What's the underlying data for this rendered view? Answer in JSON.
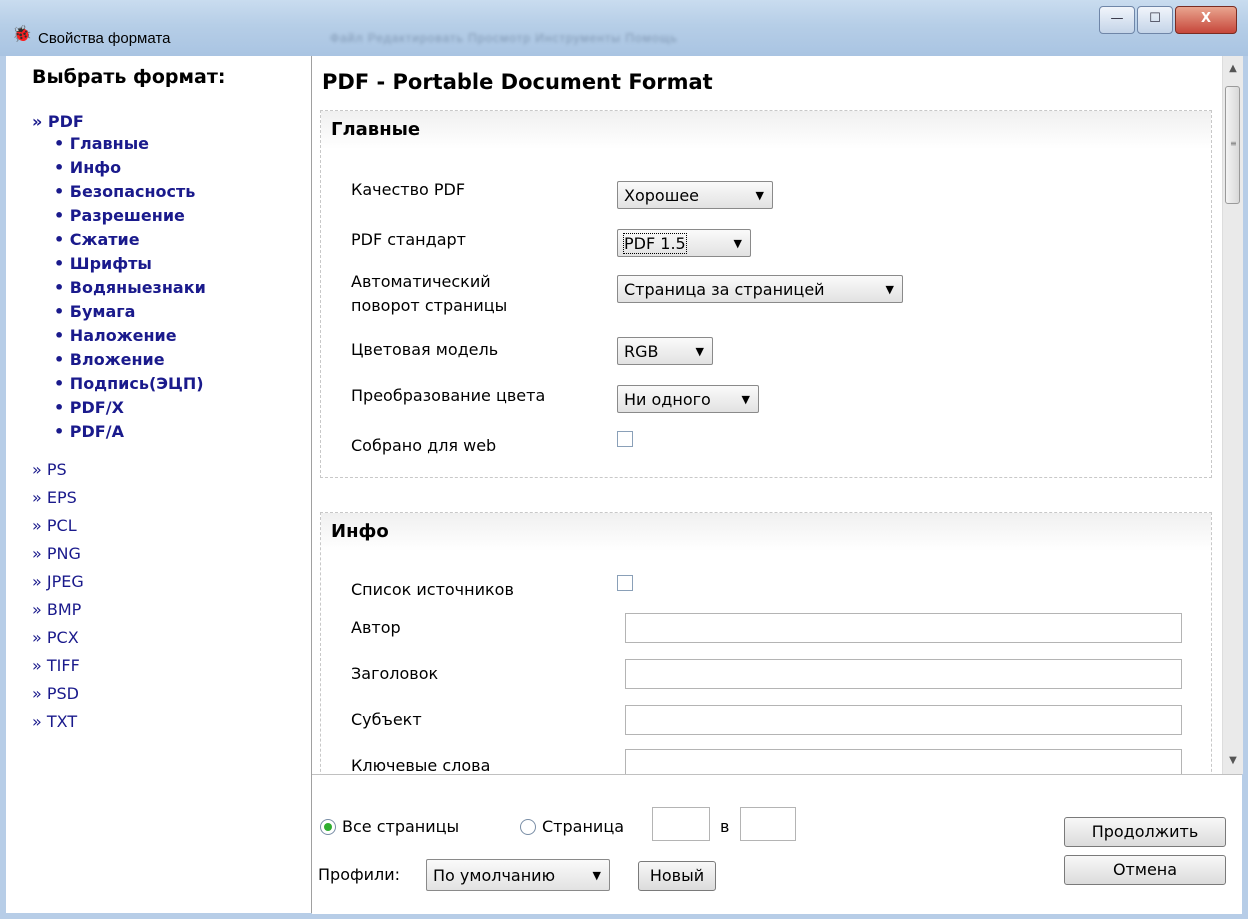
{
  "window": {
    "title": "Свойства формата",
    "blurred_menu": "Файл   Редактировать   Просмотр   Инструменты   Помощь",
    "minimize": "—",
    "maximize": "☐",
    "close": "X"
  },
  "sidebar": {
    "heading": "Выбрать формат:",
    "active_format": "» PDF",
    "pdf_sections": [
      "• Главные",
      "• Инфо",
      "• Безопасность",
      "• Разрешение",
      "• Сжатие",
      "• Шрифты",
      "• Водяныезнаки",
      "• Бумага",
      "• Наложение",
      "• Вложение",
      "• Подпись(ЭЦП)",
      "• PDF/X",
      "• PDF/A"
    ],
    "other_formats": [
      "» PS",
      "» EPS",
      "» PCL",
      "» PNG",
      "» JPEG",
      "» BMP",
      "» PCX",
      "» TIFF",
      "» PSD",
      "» TXT"
    ]
  },
  "content": {
    "title": "PDF - Portable Document Format",
    "main_section": {
      "heading": "Главные",
      "quality_label": "Качество PDF",
      "quality_value": "Хорошее",
      "standard_label": "PDF стандарт",
      "standard_value": "PDF 1.5",
      "rotate_label_1": "Автоматический",
      "rotate_label_2": "поворот страницы",
      "rotate_value": "Страница за страницей",
      "color_model_label": "Цветовая модель",
      "color_model_value": "RGB",
      "color_conv_label": "Преобразование цвета",
      "color_conv_value": "Ни одного",
      "web_label": "Собрано для web"
    },
    "info_section": {
      "heading": "Инфо",
      "sources_label": "Список источников",
      "author_label": "Автор",
      "title_label": "Заголовок",
      "subject_label": "Субъект",
      "keywords_label": "Ключевые слова"
    }
  },
  "bottom": {
    "all_pages": "Все страницы",
    "page": "Страница",
    "to": "в",
    "profiles_label": "Профили:",
    "profile_value": "По умолчанию",
    "new_button": "Новый",
    "continue_button": "Продолжить",
    "cancel_button": "Отмена"
  },
  "scrollbar": {
    "up": "▲",
    "down": "▼",
    "grip": "≡"
  }
}
